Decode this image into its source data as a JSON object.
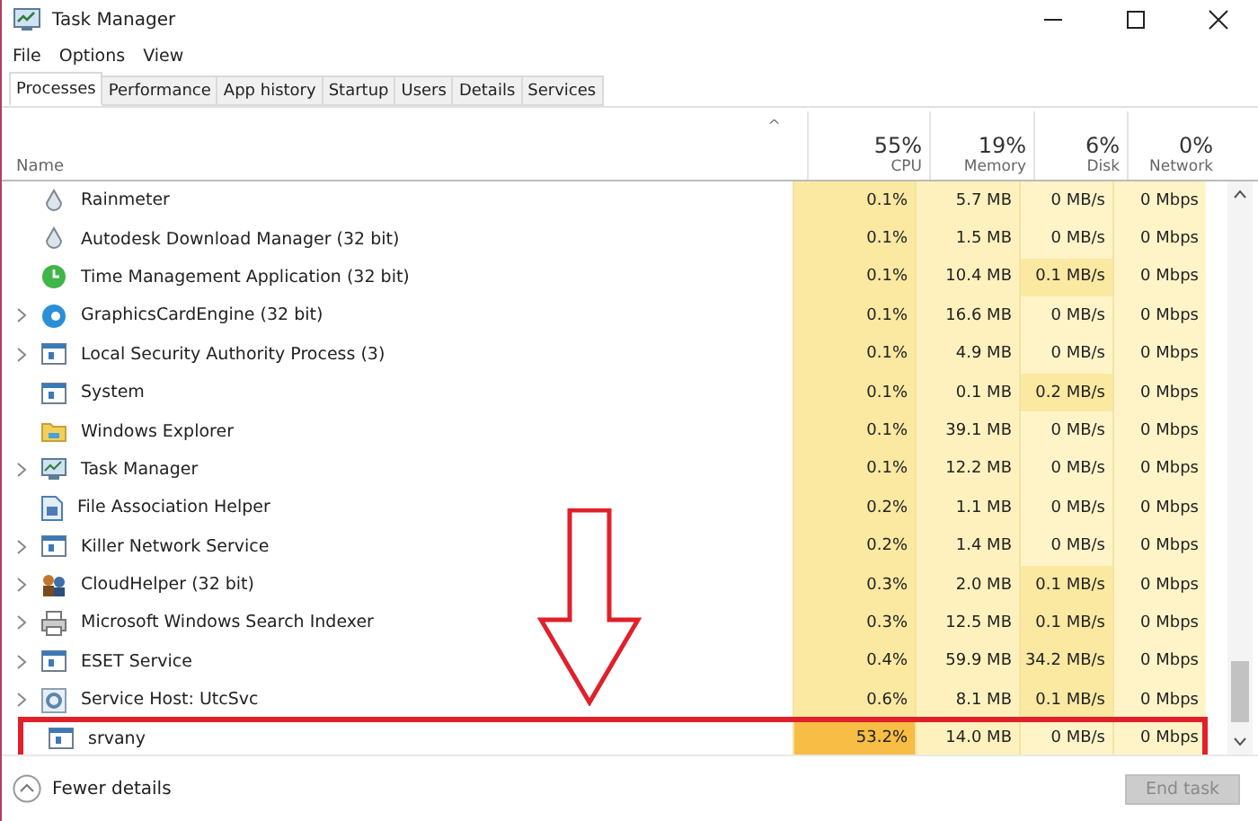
{
  "window": {
    "title": "Task Manager"
  },
  "menu": [
    "File",
    "Options",
    "View"
  ],
  "tabs": [
    {
      "label": "Processes",
      "selected": true
    },
    {
      "label": "Performance",
      "selected": false
    },
    {
      "label": "App history",
      "selected": false
    },
    {
      "label": "Startup",
      "selected": false
    },
    {
      "label": "Users",
      "selected": false
    },
    {
      "label": "Details",
      "selected": false
    },
    {
      "label": "Services",
      "selected": false
    }
  ],
  "table": {
    "name_header": "Name",
    "sort_caret": "^",
    "columns": [
      {
        "percent": "55%",
        "label": "CPU",
        "color": "#fbe9a2"
      },
      {
        "percent": "19%",
        "label": "Memory",
        "color": "#fff1bd"
      },
      {
        "percent": "6%",
        "label": "Disk",
        "color": "#fff4c8"
      },
      {
        "percent": "0%",
        "label": "Network",
        "color": "#fff4c8"
      }
    ],
    "rows": [
      {
        "name": "Rainmeter",
        "kind": "drop",
        "expandable": false,
        "marked": false,
        "cpu_high": false,
        "disk_active": false,
        "cells": [
          "0.1%",
          "5.7 MB",
          "0 MB/s",
          "0 Mbps"
        ]
      },
      {
        "name": "Autodesk Download Manager (32 bit)",
        "kind": "drop",
        "expandable": false,
        "marked": false,
        "cpu_high": false,
        "disk_active": false,
        "cells": [
          "0.1%",
          "1.5 MB",
          "0 MB/s",
          "0 Mbps"
        ]
      },
      {
        "name": "Time Management Application (32 bit)",
        "kind": "clock",
        "expandable": false,
        "marked": false,
        "cpu_high": false,
        "disk_active": true,
        "cells": [
          "0.1%",
          "10.4 MB",
          "0.1 MB/s",
          "0 Mbps"
        ]
      },
      {
        "name": "GraphicsCardEngine (32 bit)",
        "kind": "disc",
        "expandable": true,
        "marked": false,
        "cpu_high": false,
        "disk_active": false,
        "cells": [
          "0.1%",
          "16.6 MB",
          "0 MB/s",
          "0 Mbps"
        ]
      },
      {
        "name": "Local Security Authority Process (3)",
        "kind": "window",
        "expandable": true,
        "marked": false,
        "cpu_high": false,
        "disk_active": false,
        "cells": [
          "0.1%",
          "4.9 MB",
          "0 MB/s",
          "0 Mbps"
        ]
      },
      {
        "name": "System",
        "kind": "window",
        "expandable": false,
        "marked": false,
        "cpu_high": false,
        "disk_active": true,
        "cells": [
          "0.1%",
          "0.1 MB",
          "0.2 MB/s",
          "0 Mbps"
        ]
      },
      {
        "name": "Windows Explorer",
        "kind": "folder",
        "expandable": false,
        "marked": false,
        "cpu_high": false,
        "disk_active": false,
        "cells": [
          "0.1%",
          "39.1 MB",
          "0 MB/s",
          "0 Mbps"
        ]
      },
      {
        "name": "Task Manager",
        "kind": "monitor",
        "expandable": true,
        "marked": false,
        "cpu_high": false,
        "disk_active": false,
        "cells": [
          "0.1%",
          "12.2 MB",
          "0 MB/s",
          "0 Mbps"
        ]
      },
      {
        "name": "File Association Helper",
        "kind": "document",
        "expandable": false,
        "marked": false,
        "cpu_high": false,
        "disk_active": false,
        "cells": [
          "0.2%",
          "1.1 MB",
          "0 MB/s",
          "0 Mbps"
        ]
      },
      {
        "name": "Killer Network Service",
        "kind": "window",
        "expandable": true,
        "marked": false,
        "cpu_high": false,
        "disk_active": false,
        "cells": [
          "0.2%",
          "1.4 MB",
          "0 MB/s",
          "0 Mbps"
        ]
      },
      {
        "name": "CloudHelper (32 bit)",
        "kind": "people",
        "expandable": true,
        "marked": false,
        "cpu_high": false,
        "disk_active": true,
        "cells": [
          "0.3%",
          "2.0 MB",
          "0.1 MB/s",
          "0 Mbps"
        ]
      },
      {
        "name": "Microsoft Windows Search Indexer",
        "kind": "printer",
        "expandable": true,
        "marked": false,
        "cpu_high": false,
        "disk_active": true,
        "cells": [
          "0.3%",
          "12.5 MB",
          "0.1 MB/s",
          "0 Mbps"
        ]
      },
      {
        "name": "ESET Service",
        "kind": "window",
        "expandable": true,
        "marked": false,
        "cpu_high": false,
        "disk_active": true,
        "cells": [
          "0.4%",
          "59.9 MB",
          "34.2 MB/s",
          "0 Mbps"
        ]
      },
      {
        "name": "Service Host: UtcSvc",
        "kind": "gear",
        "expandable": true,
        "marked": false,
        "cpu_high": false,
        "disk_active": true,
        "cells": [
          "0.6%",
          "8.1 MB",
          "0.1 MB/s",
          "0 Mbps"
        ]
      },
      {
        "name": "srvany",
        "kind": "window",
        "expandable": false,
        "marked": true,
        "cpu_high": true,
        "disk_active": false,
        "cells": [
          "53.2%",
          "14.0 MB",
          "0 MB/s",
          "0 Mbps"
        ]
      }
    ]
  },
  "footer": {
    "details_label": "Fewer details",
    "end_task": {
      "label": "End task",
      "disabled": true
    }
  }
}
